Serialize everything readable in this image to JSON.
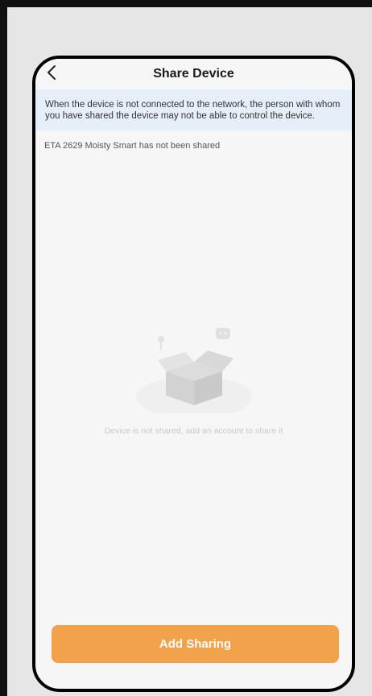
{
  "header": {
    "title": "Share Device",
    "back_icon": "chevron-left-icon"
  },
  "notice": {
    "text": "When the device is not connected to the network, the person with whom you have shared the device may not be able to control the device."
  },
  "status": {
    "text": "ETA 2629 Moisty Smart has not been shared"
  },
  "empty_state": {
    "icon": "empty-box-icon",
    "text": "Device is not shared, add an account to share it"
  },
  "actions": {
    "add_sharing_label": "Add Sharing",
    "button_color": "#f2a24a"
  },
  "colors": {
    "notice_bg": "#e6eefa",
    "screen_bg": "#f6f6f6"
  }
}
